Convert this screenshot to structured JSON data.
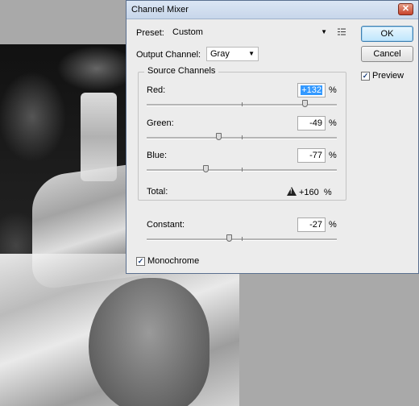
{
  "dialog": {
    "title": "Channel Mixer",
    "close_glyph": "✕",
    "preset_label": "Preset:",
    "preset_value": "Custom",
    "preset_menu_icon": "list-options-icon",
    "output_channel_label": "Output Channel:",
    "output_channel_value": "Gray",
    "source_channels_label": "Source Channels",
    "ok_label": "OK",
    "cancel_label": "Cancel",
    "preview_label": "Preview",
    "preview_checked": true,
    "monochrome_label": "Monochrome",
    "monochrome_checked": true,
    "percent": "%"
  },
  "channels": {
    "red": {
      "label": "Red:",
      "value": "+132",
      "level": 132
    },
    "green": {
      "label": "Green:",
      "value": "-49",
      "level": -49
    },
    "blue": {
      "label": "Blue:",
      "value": "-77",
      "level": -77
    }
  },
  "total": {
    "label": "Total:",
    "value": "+160",
    "unit": "%"
  },
  "constant": {
    "label": "Constant:",
    "value": "-27",
    "level": -27
  },
  "slider_range": [
    -200,
    200
  ],
  "colors": {
    "selection": "#3399ff",
    "titlebar": "#c7d6ea",
    "close": "#c7432b"
  }
}
